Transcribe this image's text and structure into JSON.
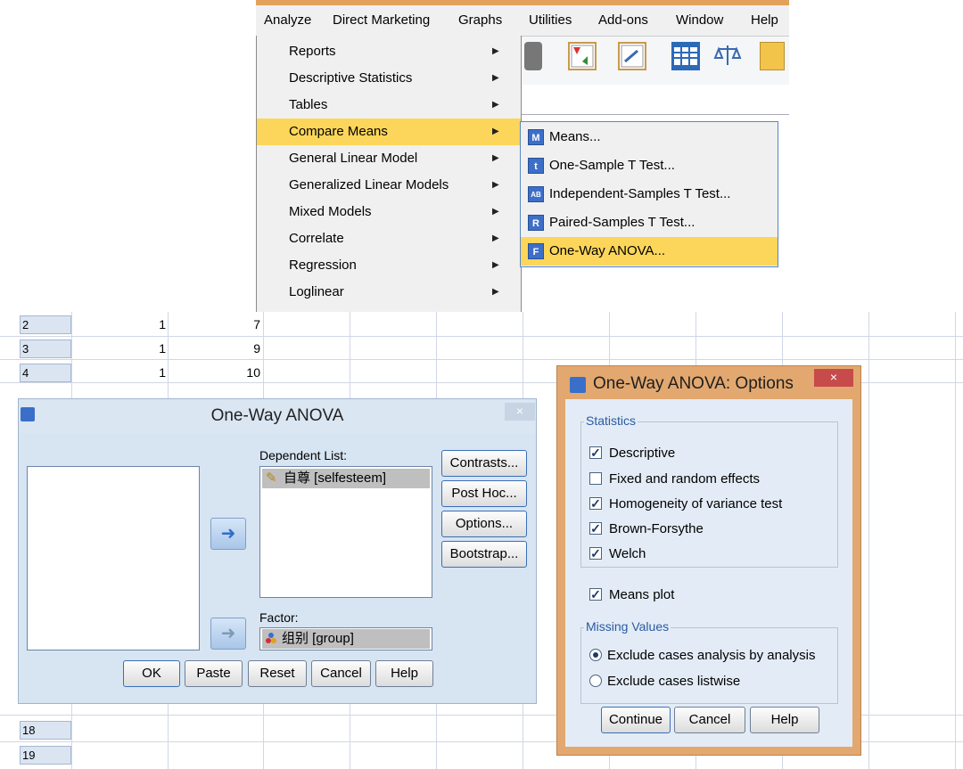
{
  "menubar": {
    "items": [
      "Analyze",
      "Direct Marketing",
      "Graphs",
      "Utilities",
      "Add-ons",
      "Window",
      "Help"
    ]
  },
  "analyze_menu": {
    "items": [
      "Reports",
      "Descriptive Statistics",
      "Tables",
      "Compare Means",
      "General Linear Model",
      "Generalized Linear Models",
      "Mixed Models",
      "Correlate",
      "Regression",
      "Loglinear"
    ],
    "highlighted": "Compare Means"
  },
  "compare_means_submenu": {
    "items": [
      {
        "icon": "M",
        "label": "Means..."
      },
      {
        "icon": "t",
        "label": "One-Sample T Test..."
      },
      {
        "icon": "AB",
        "label": "Independent-Samples T Test..."
      },
      {
        "icon": "R",
        "label": "Paired-Samples T Test..."
      },
      {
        "icon": "F",
        "label": "One-Way ANOVA..."
      }
    ],
    "highlighted": "One-Way ANOVA..."
  },
  "grid": {
    "rows": [
      {
        "num": "2",
        "a": "1",
        "b": "7"
      },
      {
        "num": "3",
        "a": "1",
        "b": "9"
      },
      {
        "num": "4",
        "a": "1",
        "b": "10"
      }
    ],
    "bottom_rows": [
      "18",
      "19"
    ]
  },
  "anova_dialog": {
    "title": "One-Way ANOVA",
    "close": "×",
    "dependent_list_label": "Dependent List:",
    "dependent_item": "自尊 [selfesteem]",
    "factor_label": "Factor:",
    "factor_item": "组别 [group]",
    "side_buttons": [
      "Contrasts...",
      "Post Hoc...",
      "Options...",
      "Bootstrap..."
    ],
    "bottom_buttons": [
      "OK",
      "Paste",
      "Reset",
      "Cancel",
      "Help"
    ]
  },
  "options_dialog": {
    "title": "One-Way ANOVA: Options",
    "close": "×",
    "statistics_label": "Statistics",
    "statistics": [
      {
        "label": "Descriptive",
        "checked": true
      },
      {
        "label": "Fixed and random effects",
        "checked": false
      },
      {
        "label": "Homogeneity of variance test",
        "checked": true
      },
      {
        "label": "Brown-Forsythe",
        "checked": true
      },
      {
        "label": "Welch",
        "checked": true
      }
    ],
    "means_plot": {
      "label": "Means plot",
      "checked": true
    },
    "missing_values_label": "Missing Values",
    "missing_values": [
      {
        "label": "Exclude cases analysis by analysis",
        "selected": true
      },
      {
        "label": "Exclude cases listwise",
        "selected": false
      }
    ],
    "buttons": [
      "Continue",
      "Cancel",
      "Help"
    ]
  }
}
